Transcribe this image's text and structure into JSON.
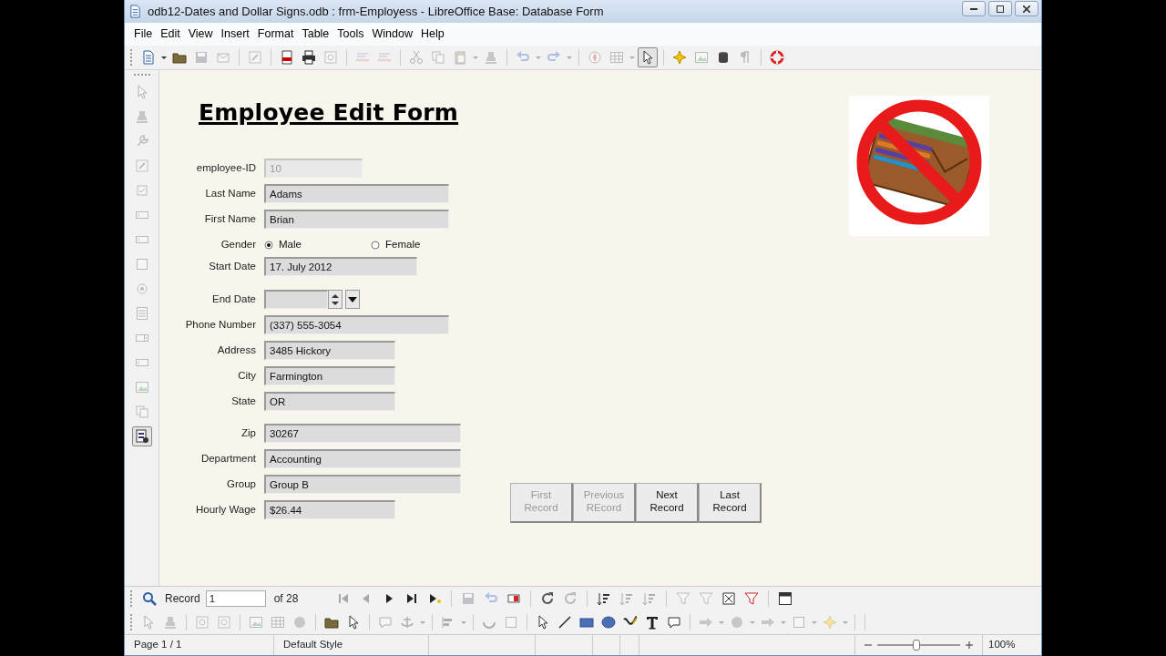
{
  "window": {
    "title": "odb12-Dates and Dollar Signs.odb : frm-Employess - LibreOffice Base: Database Form"
  },
  "menu": [
    {
      "label": "File"
    },
    {
      "label": "Edit"
    },
    {
      "label": "View"
    },
    {
      "label": "Insert"
    },
    {
      "label": "Format"
    },
    {
      "label": "Table"
    },
    {
      "label": "Tools"
    },
    {
      "label": "Window"
    },
    {
      "label": "Help"
    }
  ],
  "main_toolbar": [
    {
      "disabled": false,
      "pressed": false
    },
    {
      "disabled": false,
      "pressed": false
    },
    {
      "disabled": false,
      "pressed": false
    },
    {
      "disabled": true,
      "pressed": false
    },
    {
      "disabled": true,
      "pressed": false
    },
    {
      "disabled": true,
      "pressed": false
    },
    {
      "disabled": false,
      "pressed": false
    },
    {
      "disabled": false,
      "pressed": false
    },
    {
      "disabled": true,
      "pressed": false
    },
    {
      "disabled": true,
      "pressed": false
    },
    {
      "disabled": true,
      "pressed": false
    },
    {
      "disabled": true,
      "pressed": false
    },
    {
      "disabled": true,
      "pressed": false
    },
    {
      "disabled": true,
      "pressed": false
    },
    {
      "disabled": true,
      "pressed": false
    },
    {
      "disabled": true,
      "pressed": false
    },
    {
      "disabled": true,
      "pressed": false
    },
    {
      "disabled": true,
      "pressed": false
    },
    {
      "disabled": true,
      "pressed": false
    },
    {
      "disabled": true,
      "pressed": false
    },
    {
      "disabled": true,
      "pressed": false
    },
    {
      "disabled": true,
      "pressed": false
    },
    {
      "disabled": true,
      "pressed": false
    },
    {
      "disabled": false,
      "pressed": true
    },
    {
      "disabled": false,
      "pressed": false
    },
    {
      "disabled": true,
      "pressed": false
    },
    {
      "disabled": false,
      "pressed": false
    },
    {
      "disabled": true,
      "pressed": false
    },
    {
      "disabled": false,
      "pressed": false
    }
  ],
  "form_controls_toolbar": [
    {
      "disabled": true,
      "pressed": false
    },
    {
      "disabled": true,
      "pressed": false
    },
    {
      "disabled": true,
      "pressed": false
    },
    {
      "disabled": true,
      "pressed": false
    },
    {
      "disabled": true,
      "pressed": false
    },
    {
      "disabled": true,
      "pressed": false
    },
    {
      "disabled": true,
      "pressed": false
    },
    {
      "disabled": true,
      "pressed": false
    },
    {
      "disabled": true,
      "pressed": false
    },
    {
      "disabled": true,
      "pressed": false
    },
    {
      "disabled": true,
      "pressed": false
    },
    {
      "disabled": true,
      "pressed": false
    },
    {
      "disabled": true,
      "pressed": false
    },
    {
      "disabled": true,
      "pressed": false
    },
    {
      "disabled": false,
      "pressed": true
    }
  ],
  "form": {
    "title": "Employee Edit Form",
    "fields": [
      {
        "label": "employee-ID",
        "kind": "text",
        "value": "10",
        "disabled": true
      },
      {
        "label": "Last Name",
        "kind": "text",
        "value": "Adams",
        "disabled": false
      },
      {
        "label": "First Name",
        "kind": "text",
        "value": "Brian",
        "disabled": false
      },
      {
        "label": "Gender",
        "kind": "radio",
        "disabled": false,
        "options": [
          {
            "label": "Male",
            "selected": true
          },
          {
            "label": "Female",
            "selected": false
          }
        ]
      },
      {
        "label": "Start Date",
        "kind": "text",
        "value": "17. July 2012",
        "disabled": false
      },
      {
        "label": "End Date",
        "kind": "date",
        "disabled": false
      },
      {
        "label": "Phone Number",
        "kind": "text",
        "value": "(337) 555-3054",
        "disabled": false
      },
      {
        "label": "Address",
        "kind": "text",
        "value": "3485 Hickory",
        "disabled": false
      },
      {
        "label": "City",
        "kind": "text",
        "value": "Farmington",
        "disabled": false
      },
      {
        "label": "State",
        "kind": "text",
        "value": "OR",
        "disabled": false
      },
      {
        "label": "Zip",
        "kind": "text",
        "value": "30267",
        "disabled": false
      },
      {
        "label": "Department",
        "kind": "text",
        "value": "Accounting",
        "disabled": false
      },
      {
        "label": "Group",
        "kind": "text",
        "value": "Group B",
        "disabled": false
      },
      {
        "label": "Hourly Wage",
        "kind": "text",
        "value": "$26.44",
        "disabled": false
      }
    ],
    "buttons": [
      {
        "label": "First Record",
        "disabled": true
      },
      {
        "label": "Previous REcord",
        "disabled": true
      },
      {
        "label": "Next Record",
        "disabled": false
      },
      {
        "label": "Last Record",
        "disabled": false
      }
    ]
  },
  "record_bar": {
    "label": "Record",
    "value": "1",
    "count": "of 28"
  },
  "navigation_toolbar": [
    {
      "disabled": true
    },
    {
      "disabled": true
    },
    {
      "disabled": false
    },
    {
      "disabled": false
    },
    {
      "disabled": false
    },
    {
      "disabled": true
    },
    {
      "disabled": true
    },
    {
      "disabled": false
    },
    {
      "disabled": false
    },
    {
      "disabled": true
    },
    {
      "disabled": false
    },
    {
      "disabled": true
    },
    {
      "disabled": true
    },
    {
      "disabled": true
    },
    {
      "disabled": true
    },
    {
      "disabled": false
    },
    {
      "disabled": false
    },
    {
      "disabled": false
    }
  ],
  "drawing_toolbar": [
    {
      "disabled": true
    },
    {
      "disabled": true
    },
    {
      "disabled": true
    },
    {
      "disabled": true
    },
    {
      "disabled": true
    },
    {
      "disabled": true
    },
    {
      "disabled": true
    },
    {
      "disabled": false
    },
    {
      "disabled": false
    },
    {
      "disabled": true
    },
    {
      "disabled": true
    },
    {
      "disabled": true
    },
    {
      "disabled": true
    },
    {
      "disabled": true
    },
    {
      "disabled": true
    },
    {
      "disabled": true
    },
    {
      "disabled": false
    },
    {
      "disabled": false
    },
    {
      "disabled": false
    },
    {
      "disabled": false
    },
    {
      "disabled": false
    },
    {
      "disabled": false
    },
    {
      "disabled": false
    },
    {
      "disabled": true
    },
    {
      "disabled": true
    },
    {
      "disabled": true
    },
    {
      "disabled": true
    },
    {
      "disabled": true
    },
    {
      "disabled": true
    },
    {
      "disabled": true
    },
    {
      "disabled": true
    },
    {
      "disabled": true
    },
    {
      "disabled": true
    }
  ],
  "status_bar": {
    "page": "Page 1 / 1",
    "style": "Default Style",
    "zoom": {
      "level": 0.47,
      "reading": "100%"
    }
  }
}
